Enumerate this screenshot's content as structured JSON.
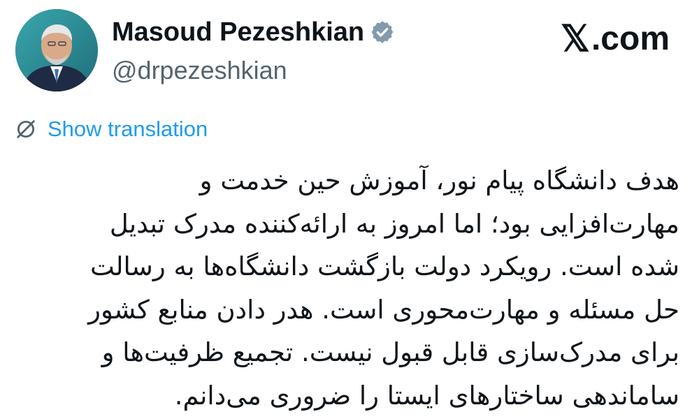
{
  "author": {
    "display_name": "Masoud Pezeshkian",
    "handle": "@drpezeshkian",
    "verified_icon": "verified-badge-icon",
    "avatar": "profile-photo"
  },
  "site": {
    "mark": "com",
    "logo_icon": "x-logo-icon",
    "full_text": "X.com"
  },
  "translate": {
    "label": "Show translation",
    "icon": "globe-icon",
    "color": "#1d9bf0"
  },
  "tweet": {
    "lines": [
      "هدف دانشگاه پیام نور، آموزش حین خدمت و",
      "مهارت‌افزایی بود؛ اما امروز به ارائه‌کننده مدرک تبدیل",
      "شده است. رویکرد دولت بازگشت دانشگاه‌ها به رسالت",
      "حل مسئله و مهارت‌محوری است. هدر دادن منابع کشور",
      "برای مدرک‌سازی قابل قبول نیست. تجمیع ظرفیت‌ها و",
      "ساماندهی ساختارهای ایستا را ضروری می‌دانم."
    ]
  },
  "colors": {
    "text": "#0f1419",
    "secondary": "#536471",
    "link": "#1d9bf0",
    "badge": "#829aab"
  }
}
